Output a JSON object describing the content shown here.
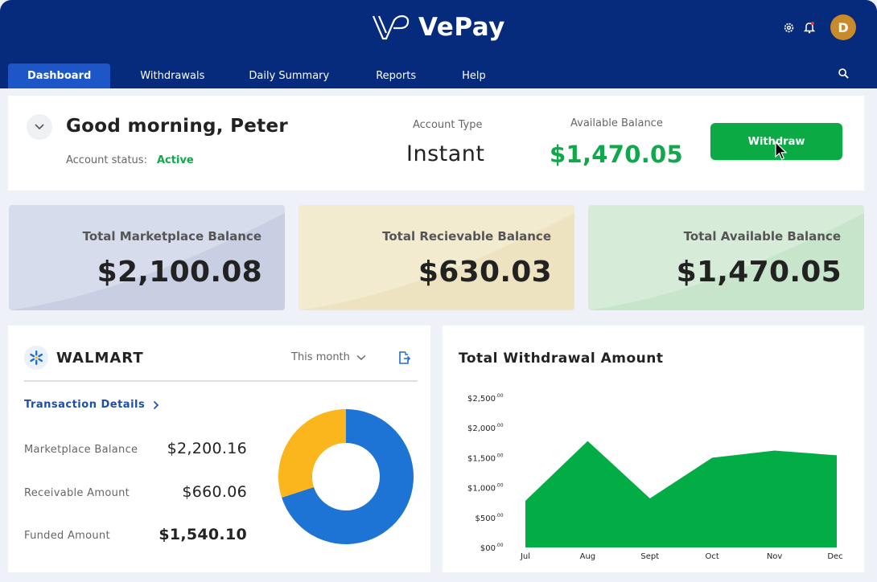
{
  "app": {
    "brand": "VePay",
    "avatar_initial": "D"
  },
  "nav": {
    "tabs": [
      {
        "label": "Dashboard",
        "active": true
      },
      {
        "label": "Withdrawals"
      },
      {
        "label": "Daily Summary"
      },
      {
        "label": "Reports"
      },
      {
        "label": "Help"
      }
    ]
  },
  "greeting": {
    "title": "Good morning, Peter",
    "status_label": "Account status:",
    "status_value": "Active",
    "account_type_label": "Account Type",
    "account_type_value": "Instant",
    "available_label": "Available Balance",
    "available_value": "$1,470.05",
    "withdraw_label": "Withdraw"
  },
  "balances": [
    {
      "label": "Total Marketplace Balance",
      "value": "$2,100.08"
    },
    {
      "label": "Total Recievable Balance",
      "value": "$630.03"
    },
    {
      "label": "Total Available Balance",
      "value": "$1,470.05"
    }
  ],
  "walmart": {
    "name": "WALMART",
    "period": "This month",
    "link": "Transaction Details",
    "rows": [
      {
        "label": "Marketplace Balance",
        "value": "$2,200.16"
      },
      {
        "label": "Receivable Amount",
        "value": "$660.06"
      },
      {
        "label": "Funded Amount",
        "value": "$1,540.10"
      }
    ],
    "donut": {
      "segments": [
        0.7,
        0.3
      ],
      "colors": [
        "#1e74d4",
        "#fbb61d"
      ]
    }
  },
  "colors": {
    "header": "#062a7c",
    "active_tab": "#1d56c6",
    "green": "#0caa45",
    "link": "#1c4fa8"
  },
  "chart_data": {
    "type": "area",
    "title": "Total Withdrawal Amount",
    "x": [
      "Jul",
      "Aug",
      "Sept",
      "Oct",
      "Nov",
      "Dec"
    ],
    "values": [
      780,
      1780,
      820,
      1500,
      1620,
      1540
    ],
    "y_ticks": [
      {
        "main": "$2,500",
        "sup": ".00",
        "v": 2500
      },
      {
        "main": "$2,000",
        "sup": ".00",
        "v": 2000
      },
      {
        "main": "$1,500",
        "sup": ".00",
        "v": 1500
      },
      {
        "main": "$1,000",
        "sup": ".00",
        "v": 1000
      },
      {
        "main": "$500",
        "sup": ".00",
        "v": 500
      },
      {
        "main": "$00",
        "sup": ".00",
        "v": 0
      }
    ],
    "ylim": [
      0,
      2500
    ],
    "color": "#02ad45",
    "grid": false
  }
}
